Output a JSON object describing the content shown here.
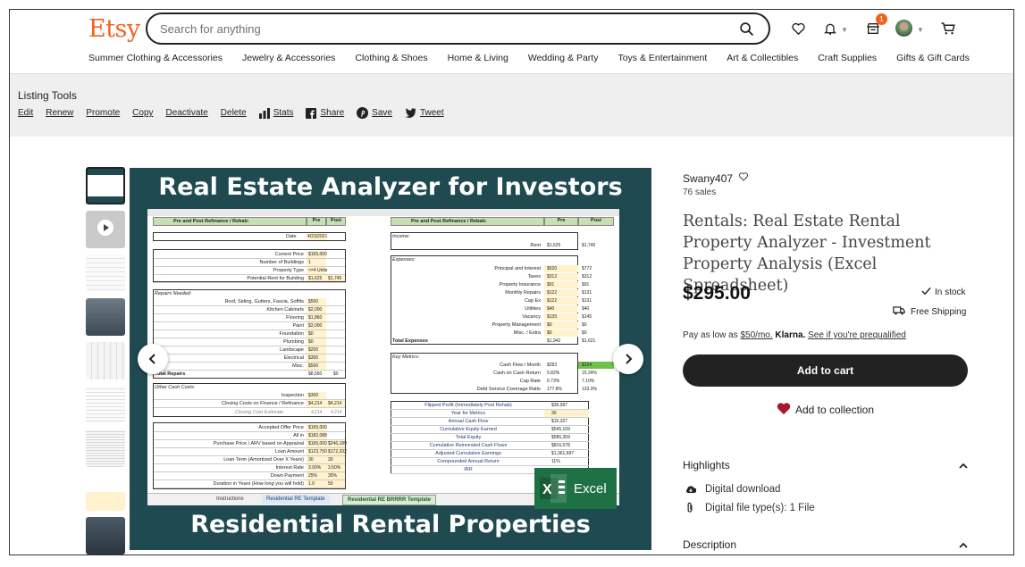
{
  "header": {
    "logo": "Etsy",
    "search_placeholder": "Search for anything",
    "cart_badge": "1"
  },
  "nav": [
    "Summer Clothing & Accessories",
    "Jewelry & Accessories",
    "Clothing & Shoes",
    "Home & Living",
    "Wedding & Party",
    "Toys & Entertainment",
    "Art & Collectibles",
    "Craft Supplies",
    "Gifts & Gift Cards"
  ],
  "listing_tools": {
    "title": "Listing Tools",
    "links": [
      "Edit",
      "Renew",
      "Promote",
      "Copy",
      "Deactivate",
      "Delete",
      "Stats",
      "Share",
      "Save",
      "Tweet"
    ]
  },
  "image": {
    "top_title": "Real Estate Analyzer for Investors",
    "bottom_title": "Residential Rental Properties",
    "excel_label": "Excel",
    "sheet": {
      "left_header": "Pre and Post Refinance / Rehab:",
      "pre": "Pre",
      "post": "Post",
      "right_header": "Pre and Post Refinance / Rebab:",
      "date_label": "Date",
      "date_value": "4/23/2021",
      "left_rows": [
        [
          "Current Price",
          "$165,000",
          ""
        ],
        [
          "Number of Buildings",
          "1",
          ""
        ],
        [
          "Property Type",
          "<=4 Units",
          ""
        ],
        [
          "Potential Rent for Building",
          "$1,625",
          "$1,745"
        ],
        [
          "Roof, Siding, Gutters, Fascia, Soffits",
          "$500",
          ""
        ],
        [
          "Kitchen Cabinets",
          "$2,000",
          ""
        ],
        [
          "Flooring",
          "$1,860",
          ""
        ],
        [
          "Paint",
          "$3,000",
          ""
        ],
        [
          "Foundation",
          "$0",
          ""
        ],
        [
          "Plumbing",
          "$0",
          ""
        ],
        [
          "Landscape",
          "$200",
          ""
        ],
        [
          "Electrical",
          "$300",
          ""
        ],
        [
          "Misc.",
          "$500",
          ""
        ],
        [
          "Inspection",
          "$300",
          ""
        ],
        [
          "Closing Costs on Finance / Refinance",
          "$4,214",
          "$4,214"
        ],
        [
          "Accepted Offer Price",
          "$165,000",
          ""
        ],
        [
          "All in",
          "$182,088",
          ""
        ],
        [
          "Purchase Price / ARV based on Appraisal",
          "$165,000",
          "$246,189"
        ],
        [
          "Loan Amount",
          "$123,750",
          "$172,332"
        ],
        [
          "Loan Term (Amortized Over X Years)",
          "30",
          "30"
        ],
        [
          "Interest Rate",
          "3.00%",
          "3.50%"
        ],
        [
          "Down Payment",
          "25%",
          "30%"
        ],
        [
          "Duration in Years (How long you will hold)",
          "1.0",
          "50"
        ]
      ],
      "repairs_needed": "Repairs Needed:",
      "total_repairs": [
        "Total Repairs",
        "$8,560",
        "$0"
      ],
      "other_cash": "Other Cash Costs:",
      "closing_estimate": [
        "Closing Cost Estimate",
        "4,214",
        "4,214"
      ],
      "income_label": "Income:",
      "rent_row": [
        "Rent",
        "$1,625",
        "$1,745"
      ],
      "expenses_label": "Expenses:",
      "expense_rows": [
        [
          "Principal and Interest",
          "$520",
          "$772"
        ],
        [
          "Taxes",
          "$312",
          "$312"
        ],
        [
          "Property Insurance",
          "$91",
          "$91"
        ],
        [
          "Monthly Repairs",
          "$122",
          "$131"
        ],
        [
          "Cap Ex",
          "$122",
          "$131"
        ],
        [
          "Utilities",
          "$40",
          "$40"
        ],
        [
          "Vacancy",
          "$135",
          "$145"
        ],
        [
          "Property Management",
          "$0",
          "$0"
        ],
        [
          "Misc. / Extra",
          "$0",
          "$0"
        ]
      ],
      "total_expenses": [
        "Total Expenses",
        "$1,942",
        "$1,621"
      ],
      "key_metrics_label": "Key Metrics:",
      "metrics_rows": [
        [
          "Cash Flow / Month",
          "$283",
          "$124"
        ],
        [
          "Cash on Cash Return",
          "5.82%",
          "15.24%"
        ],
        [
          "Cap Rate",
          "6.73%",
          "7.10%"
        ],
        [
          "Debt Service Coverage Ratio",
          "177.8%",
          "133.0%"
        ]
      ],
      "flip_rows": [
        [
          "Flipped Profit (Immediately Post Rehab)",
          "$36,997"
        ],
        [
          "Year for Metrics",
          "30"
        ],
        [
          "Annual Cash Flow",
          "$15,327"
        ],
        [
          "Cumulative Equity Earned",
          "$545,109"
        ],
        [
          "Total Equity",
          "$586,359"
        ],
        [
          "Cumulative Reinvested Cash Flows",
          "$816,578"
        ],
        [
          "Adjusted Cumulative Earnings",
          "$1,361,687"
        ],
        [
          "Compounded Annual Return",
          "11%"
        ],
        [
          "IRR",
          ""
        ]
      ],
      "tabs": [
        "Instructions",
        "Residential RE Template",
        "Residential RE BRRRR Template"
      ]
    }
  },
  "product": {
    "seller": "Swany407",
    "sales": "76 sales",
    "title": "Rentals: Real Estate Rental Property Analyzer - Investment Property Analysis (Excel Spreadsheet)",
    "price": "$295.00",
    "in_stock": "In stock",
    "free_shipping": "Free Shipping",
    "klarna_prefix": "Pay as low as ",
    "klarna_amount": "$50/mo.",
    "klarna_brand": "Klarna.",
    "klarna_link": "See if you're prequalified",
    "add_to_cart": "Add to cart",
    "add_to_collection": "Add to collection",
    "highlights_title": "Highlights",
    "highlights": [
      "Digital download",
      "Digital file type(s): 1 File"
    ],
    "description_title": "Description"
  },
  "colors": {
    "brand": "#f1641e",
    "image_bg": "#1e4a50",
    "excel_green": "#1e7145"
  }
}
